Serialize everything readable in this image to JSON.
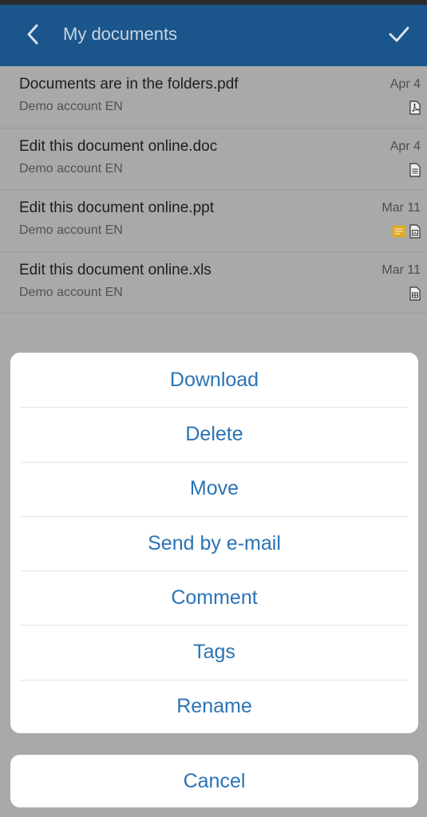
{
  "header": {
    "title": "My documents",
    "back_icon": "chevron-left-icon",
    "confirm_icon": "checkmark-icon",
    "color": "#1a558b"
  },
  "documents": [
    {
      "name": "Documents are in the folders.pdf",
      "owner": "Demo account EN",
      "date": "Apr 4",
      "type_icon": "pdf-file-icon",
      "has_note": false
    },
    {
      "name": "Edit this document online.doc",
      "owner": "Demo account EN",
      "date": "Apr 4",
      "type_icon": "doc-file-icon",
      "has_note": false
    },
    {
      "name": "Edit this document online.ppt",
      "owner": "Demo account EN",
      "date": "Mar 11",
      "type_icon": "ppt-file-icon",
      "has_note": true
    },
    {
      "name": "Edit this document online.xls",
      "owner": "Demo account EN",
      "date": "Mar 11",
      "type_icon": "xls-file-icon",
      "has_note": false
    }
  ],
  "action_sheet": {
    "items": [
      "Download",
      "Delete",
      "Move",
      "Send by e-mail",
      "Comment",
      "Tags",
      "Rename"
    ],
    "cancel_label": "Cancel",
    "accent": "#2b73b5"
  }
}
